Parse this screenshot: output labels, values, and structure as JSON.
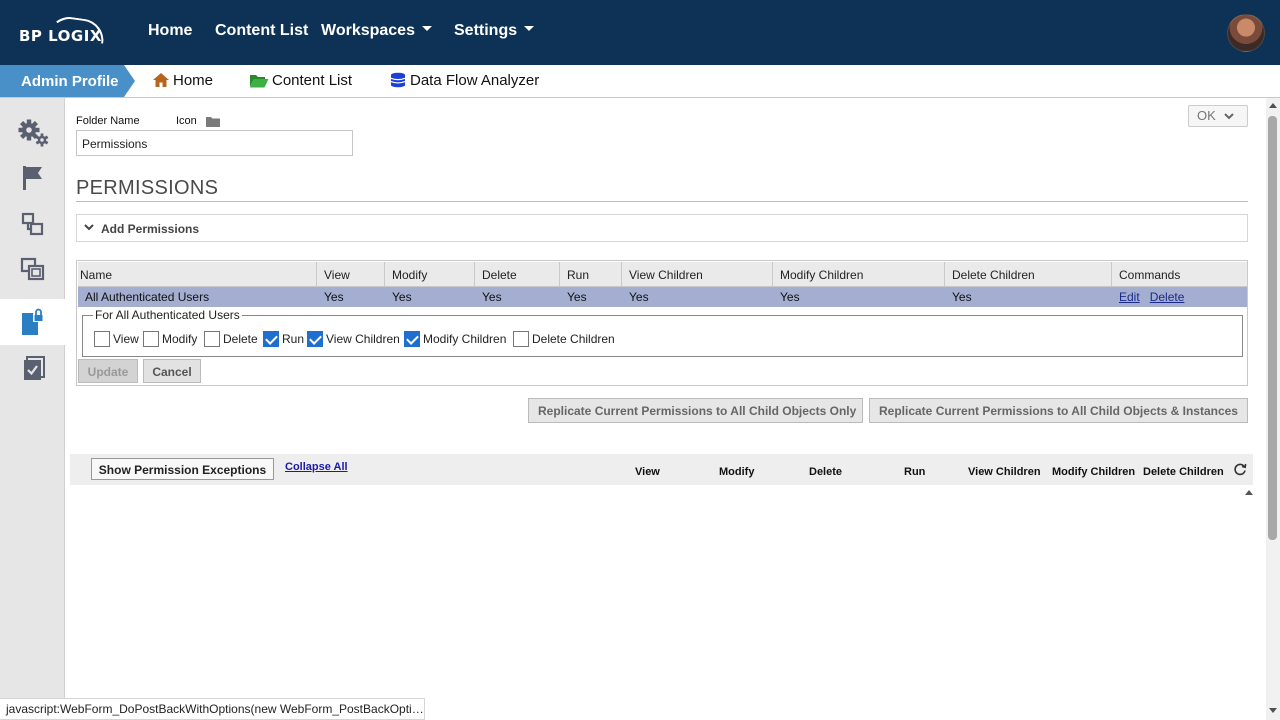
{
  "brand": {
    "logo_text": "BP LOGIX"
  },
  "topnav": {
    "items": [
      "Home",
      "Content List",
      "Workspaces",
      "Settings"
    ]
  },
  "subnav": {
    "admin_label": "Admin Profile",
    "items": [
      "Home",
      "Content List",
      "Data Flow Analyzer"
    ]
  },
  "sidebar": {
    "items": [
      "settings-gears",
      "flag",
      "link-nodes",
      "copy-windows",
      "lock-document",
      "checklist"
    ],
    "active_index": 4
  },
  "folder": {
    "name_label": "Folder Name",
    "icon_label": "Icon",
    "name_value": "Permissions"
  },
  "ok_button": "OK",
  "permissions": {
    "title": "PERMISSIONS",
    "add_label": "Add Permissions",
    "columns": [
      "Name",
      "View",
      "Modify",
      "Delete",
      "Run",
      "View Children",
      "Modify Children",
      "Delete Children",
      "Commands"
    ],
    "rows": [
      {
        "name": "All Authenticated Users",
        "view": "Yes",
        "modify": "Yes",
        "delete": "Yes",
        "run": "Yes",
        "view_children": "Yes",
        "modify_children": "Yes",
        "delete_children": "Yes",
        "edit": "Edit",
        "delete_cmd": "Delete"
      }
    ],
    "edit_group": {
      "legend": "For All Authenticated Users",
      "options": [
        {
          "label": "View",
          "checked": false
        },
        {
          "label": "Modify",
          "checked": false
        },
        {
          "label": "Delete",
          "checked": false
        },
        {
          "label": "Run",
          "checked": true
        },
        {
          "label": "View Children",
          "checked": true
        },
        {
          "label": "Modify Children",
          "checked": true
        },
        {
          "label": "Delete Children",
          "checked": false
        }
      ],
      "update_label": "Update",
      "cancel_label": "Cancel"
    },
    "replicate_child_only": "Replicate Current Permissions to All Child Objects Only",
    "replicate_child_instances": "Replicate Current Permissions to All Child Objects & Instances"
  },
  "exceptions": {
    "show_label": "Show Permission Exceptions",
    "collapse_label": "Collapse All",
    "columns": [
      "View",
      "Modify",
      "Delete",
      "Run",
      "View Children",
      "Modify Children",
      "Delete Children"
    ]
  },
  "status_bar": "javascript:WebForm_DoPostBackWithOptions(new WebForm_PostBackOptio..."
}
